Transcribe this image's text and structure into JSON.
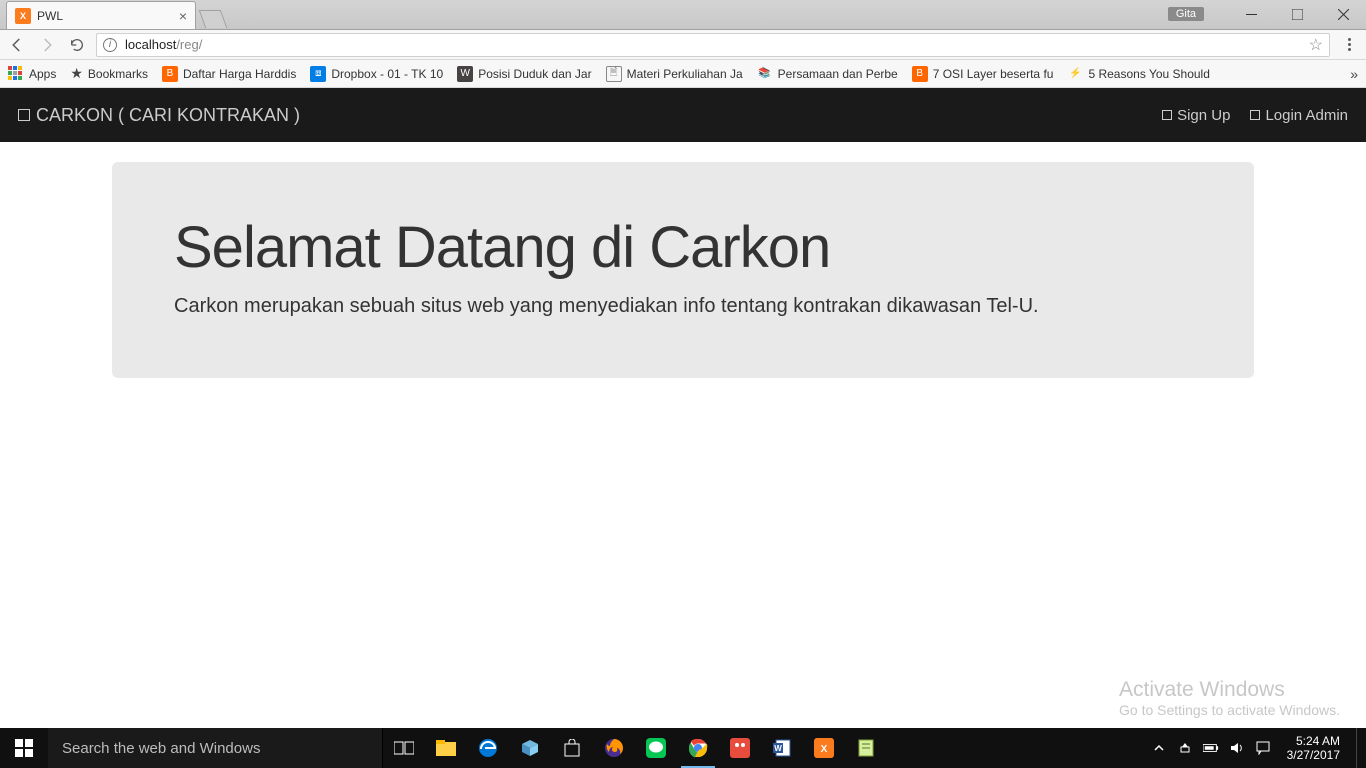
{
  "browser": {
    "tab_title": "PWL",
    "user_badge": "Gita",
    "url_host": "localhost",
    "url_path": "/reg/"
  },
  "bookmarks": {
    "apps_label": "Apps",
    "items": [
      "Bookmarks",
      "Daftar Harga Harddis",
      "Dropbox - 01 - TK 10",
      "Posisi Duduk dan Jar",
      "Materi Perkuliahan Ja",
      "Persamaan dan Perbe",
      "7 OSI Layer beserta fu",
      "5 Reasons You Should"
    ]
  },
  "page": {
    "brand": "CARKON ( CARI KONTRAKAN )",
    "nav_signup": "Sign Up",
    "nav_login": "Login Admin",
    "hero_title": "Selamat Datang di Carkon",
    "hero_sub": "Carkon merupakan sebuah situs web yang menyediakan info tentang kontrakan dikawasan Tel-U."
  },
  "watermark": {
    "line1": "Activate Windows",
    "line2": "Go to Settings to activate Windows."
  },
  "taskbar": {
    "search_placeholder": "Search the web and Windows",
    "time": "5:24 AM",
    "date": "3/27/2017"
  }
}
